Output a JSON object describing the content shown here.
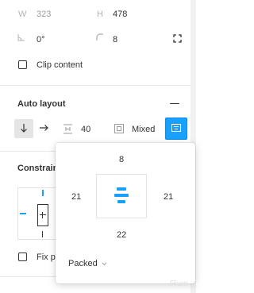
{
  "size": {
    "w_label": "W",
    "w_value": "323",
    "h_label": "H",
    "h_value": "478"
  },
  "transform": {
    "rotation_value": "0°",
    "radius_value": "8"
  },
  "frame": {
    "clip_label": "Clip content",
    "clip_checked": false
  },
  "auto_layout": {
    "title": "Auto layout",
    "spacing_value": "40",
    "padding_value": "Mixed"
  },
  "constraints": {
    "title_visible": "Constrain",
    "fix_label_visible": "Fix p"
  },
  "popover": {
    "padding_top": "8",
    "padding_left": "21",
    "padding_right": "21",
    "padding_bottom": "22",
    "distribution_label": "Packed"
  },
  "colors": {
    "accent": "#18a0fb",
    "accent_dark": "#0d8ae6"
  },
  "watermark": "Plum"
}
